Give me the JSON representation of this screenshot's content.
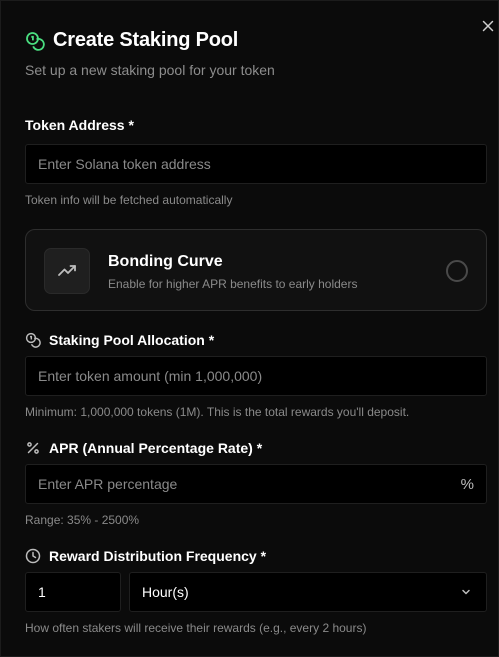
{
  "header": {
    "title": "Create Staking Pool",
    "subtitle": "Set up a new staking pool for your token",
    "logo_icon": "coins-icon",
    "accent": "#4ade80"
  },
  "token_address": {
    "label": "Token Address *",
    "placeholder": "Enter Solana token address",
    "hint": "Token info will be fetched automatically"
  },
  "bonding_curve": {
    "title": "Bonding Curve",
    "description": "Enable for higher APR benefits to early holders",
    "icon": "trending-up-icon",
    "enabled": false
  },
  "allocation": {
    "label": "Staking Pool Allocation *",
    "icon": "coins-icon",
    "placeholder": "Enter token amount (min 1,000,000)",
    "hint": "Minimum: 1,000,000 tokens (1M). This is the total rewards you'll deposit."
  },
  "apr": {
    "label": "APR (Annual Percentage Rate) *",
    "icon": "percent-icon",
    "placeholder": "Enter APR percentage",
    "suffix": "%",
    "hint": "Range: 35% - 2500%"
  },
  "frequency": {
    "label": "Reward Distribution Frequency *",
    "icon": "clock-icon",
    "value": "1",
    "unit": "Hour(s)",
    "hint": "How often stakers will receive their rewards (e.g., every 2 hours)"
  }
}
